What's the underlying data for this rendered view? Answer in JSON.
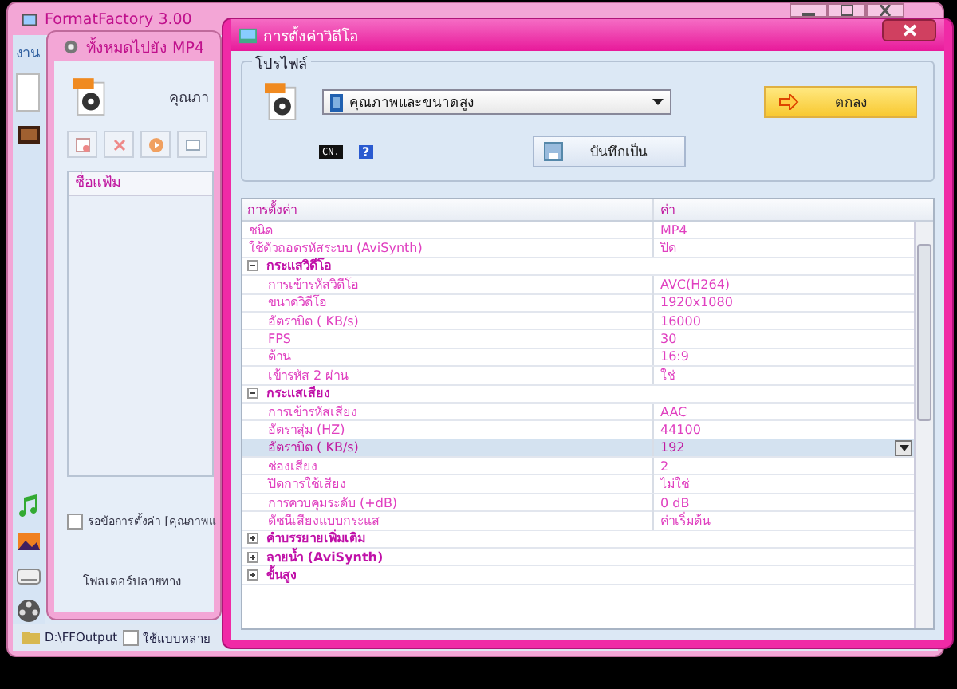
{
  "main_window": {
    "title": "FormatFactory 3.00",
    "menu_fragment": "งาน",
    "status_bar": {
      "output_folder": "D:\\FFOutput",
      "multi_option": {
        "label": "ใช้แบบหลาย",
        "checked": false
      }
    }
  },
  "convert_window": {
    "title": "ทั้งหมดไปยัง MP4",
    "quality_label": "คุณภา",
    "file_column": "ชื่อแฟ้ม",
    "wait_option": {
      "label": "รอข้อการตั้งค่า [คุณภาพแ",
      "checked": false
    },
    "output_label": "โฟลเดอร์ปลายทาง"
  },
  "settings_window": {
    "title": "การตั้งค่าวิดีโอ",
    "profile_group": "โปรไฟล์",
    "profile_value": "คุณภาพและขนาดสูง",
    "ok_button": "ตกลง",
    "save_as_button": "บันทึกเป็น",
    "console_badge": "CN.",
    "help_badge": "?",
    "grid": {
      "columns": [
        "การตั้งค่า",
        "ค่า"
      ],
      "rows": [
        {
          "kind": "item",
          "label": "ชนิด",
          "value": "MP4",
          "selected": false
        },
        {
          "kind": "item",
          "label": "ใช้ตัวถอดรหัสระบบ (AviSynth)",
          "value": "ปิด",
          "selected": false
        },
        {
          "kind": "group",
          "label": "กระแสวิดีโอ",
          "expanded": true,
          "children": [
            {
              "kind": "item",
              "label": "การเข้ารหัสวิดีโอ",
              "value": "AVC(H264)",
              "selected": false
            },
            {
              "kind": "item",
              "label": "ขนาดวิดีโอ",
              "value": "1920x1080",
              "selected": false
            },
            {
              "kind": "item",
              "label": "อัตราบิต ( KB/s)",
              "value": "16000",
              "selected": false
            },
            {
              "kind": "item",
              "label": "FPS",
              "value": "30",
              "selected": false
            },
            {
              "kind": "item",
              "label": "ด้าน",
              "value": "16:9",
              "selected": false
            },
            {
              "kind": "item",
              "label": "เข้ารหัส 2 ผ่าน",
              "value": "ใช่",
              "selected": false
            }
          ]
        },
        {
          "kind": "group",
          "label": "กระแสเสียง",
          "expanded": true,
          "children": [
            {
              "kind": "item",
              "label": "การเข้ารหัสเสียง",
              "value": "AAC",
              "selected": false
            },
            {
              "kind": "item",
              "label": "อัตราสุ่ม (HZ)",
              "value": "44100",
              "selected": false
            },
            {
              "kind": "item",
              "label": "อัตราบิต ( KB/s)",
              "value": "192",
              "selected": true
            },
            {
              "kind": "item",
              "label": "ช่องเสียง",
              "value": "2",
              "selected": false
            },
            {
              "kind": "item",
              "label": "ปิดการใช้เสียง",
              "value": "ไม่ใช่",
              "selected": false
            },
            {
              "kind": "item",
              "label": "การควบคุมระดับ (+dB)",
              "value": "0 dB",
              "selected": false
            },
            {
              "kind": "item",
              "label": "ดัชนีเสียงแบบกระแส",
              "value": "ค่าเริ่มต้น",
              "selected": false
            }
          ]
        },
        {
          "kind": "group",
          "label": "คำบรรยายเพิ่มเติม",
          "expanded": false
        },
        {
          "kind": "group",
          "label": "ลายน้ำ (AviSynth)",
          "expanded": false
        },
        {
          "kind": "group",
          "label": "ขั้นสูง",
          "expanded": false
        }
      ]
    }
  }
}
